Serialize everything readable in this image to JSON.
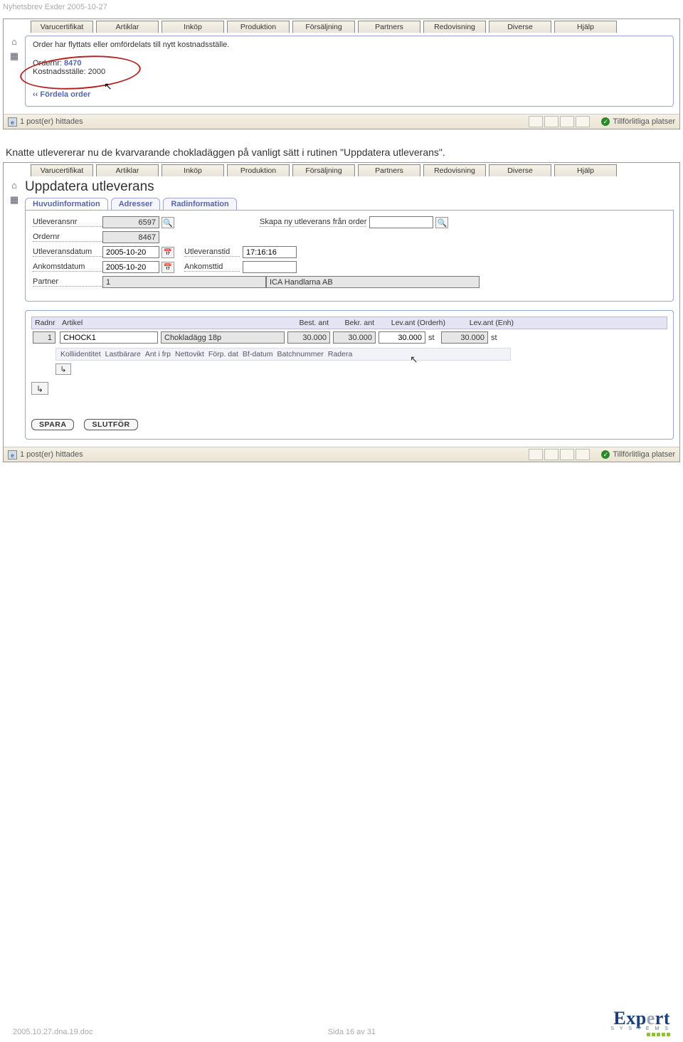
{
  "header": "Nyetsbrev Exder 2005-10-27",
  "header_fixed": "Nyhetsbrev Exder 2005-10-27",
  "menubar": [
    "Varucertifikat",
    "Artiklar",
    "Inköp",
    "Produktion",
    "Försäljning",
    "Partners",
    "Redovisning",
    "Diverse",
    "Hjälp"
  ],
  "panel1": {
    "msg": "Order har flyttats eller omfördelats till nytt kostnadsställe.",
    "ordernr_lbl": "Ordernr:",
    "ordernr_val": "8470",
    "kost_lbl": "Kostnadsställe:",
    "kost_val": "2000",
    "link": "‹‹ Fördela order"
  },
  "status": {
    "left": "1 post(er) hittades",
    "right": "Tillförlitliga platser"
  },
  "body_text": "Knatte utlevererar nu de kvarvarande chokladäggen på vanligt sätt i rutinen \"Uppdatera utleverans\".",
  "panel2": {
    "title": "Uppdatera utleverans",
    "tabs": [
      "Huvudinformation",
      "Adresser",
      "Radinformation"
    ],
    "labels": {
      "utlevnr": "Utleveransnr",
      "ordernr": "Ordernr",
      "utlevdat": "Utleveransdatum",
      "ankdat": "Ankomstdatum",
      "partner": "Partner",
      "skapa": "Skapa ny utleverans från order",
      "utlevtid": "Utleveranstid",
      "anktid": "Ankomsttid"
    },
    "values": {
      "utlevnr": "6597",
      "ordernr": "8467",
      "utlevdat": "2005-10-20",
      "ankdat": "2005-10-20",
      "utlevtid": "17:16:16",
      "anktid": "",
      "partner_id": "1",
      "partner_name": "ICA Handlarna AB",
      "skapa": ""
    },
    "grid": {
      "head": [
        "Radnr",
        "Artikel",
        "",
        "Best. ant",
        "Bekr. ant",
        "Lev.ant (Orderh)",
        "Lev.ant (Enh)"
      ],
      "row": {
        "radnr": "1",
        "art_code": "CHOCK1",
        "art_name": "Chokladägg 18p",
        "best": "30.000",
        "bekr": "30.000",
        "lev_oe": "30.000",
        "unit1": "st",
        "lev_enh": "30.000",
        "unit2": "st"
      },
      "subhead": [
        "Kolliidentitet",
        "Lastbärare",
        "Ant i frp",
        "Nettovikt",
        "Förp. dat",
        "Bf-datum",
        "Batchnummer",
        "Radera"
      ]
    },
    "buttons": {
      "spara": "SPARA",
      "slutfor": "SLUTFÖR"
    }
  },
  "footer": {
    "left": "2005.10.27.dna.19.doc",
    "mid": "Sida 16 av 31",
    "logo_main": "Expert",
    "logo_sub": "S Y S T E M S"
  }
}
